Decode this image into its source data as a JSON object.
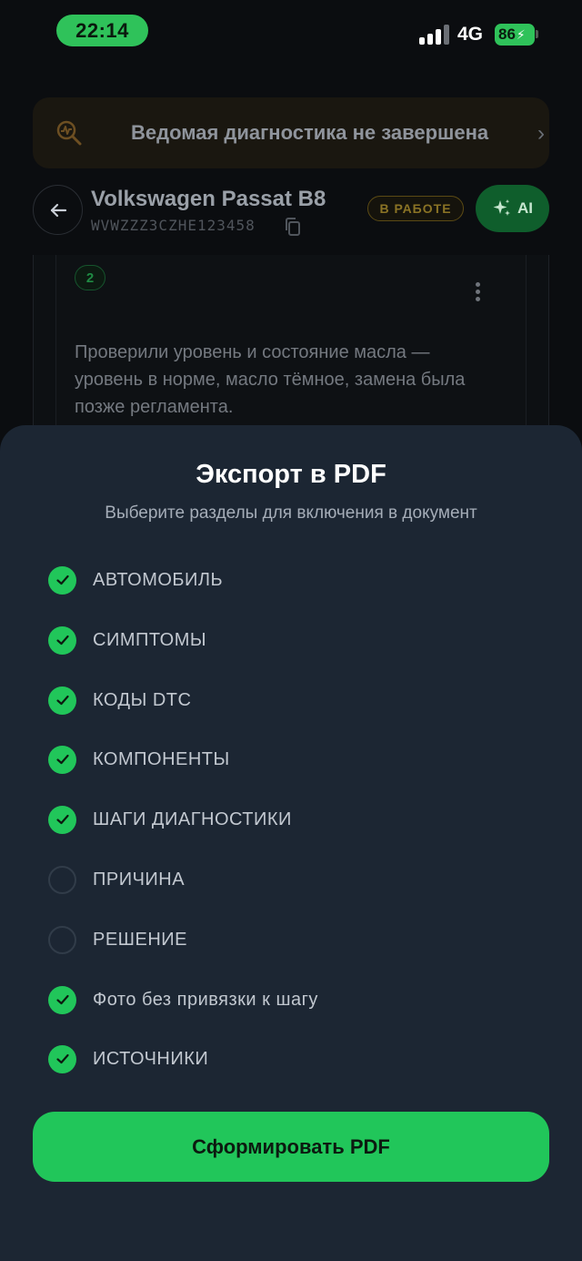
{
  "status_bar": {
    "time": "22:14",
    "network": "4G",
    "battery": "86"
  },
  "banner": {
    "text": "Ведомая диагностика не завершена",
    "icon": "diagnostic-magnifier-icon"
  },
  "vehicle": {
    "title": "Volkswagen Passat B8",
    "vin": "WVWZZZ3CZHE123458",
    "status": "В РАБОТЕ",
    "ai_label": "AI"
  },
  "step": {
    "number": "2",
    "text": "Проверили уровень и состояние масла — уровень в норме, масло тёмное, замена была позже регламента."
  },
  "export_sheet": {
    "title": "Экспорт в PDF",
    "subtitle": "Выберите разделы для включения в документ",
    "options": [
      {
        "label": "АВТОМОБИЛЬ",
        "checked": true
      },
      {
        "label": "СИМПТОМЫ",
        "checked": true
      },
      {
        "label": "КОДЫ DTC",
        "checked": true
      },
      {
        "label": "КОМПОНЕНТЫ",
        "checked": true
      },
      {
        "label": "ШАГИ ДИАГНОСТИКИ",
        "checked": true
      },
      {
        "label": "ПРИЧИНА",
        "checked": false
      },
      {
        "label": "РЕШЕНИЕ",
        "checked": false
      },
      {
        "label": "Фото без привязки к шагу",
        "checked": true
      },
      {
        "label": "ИСТОЧНИКИ",
        "checked": true
      }
    ],
    "generate_label": "Сформировать PDF"
  },
  "colors": {
    "accent": "#21c65a",
    "sheet_bg": "#1c2633",
    "warning": "#8a7325"
  }
}
